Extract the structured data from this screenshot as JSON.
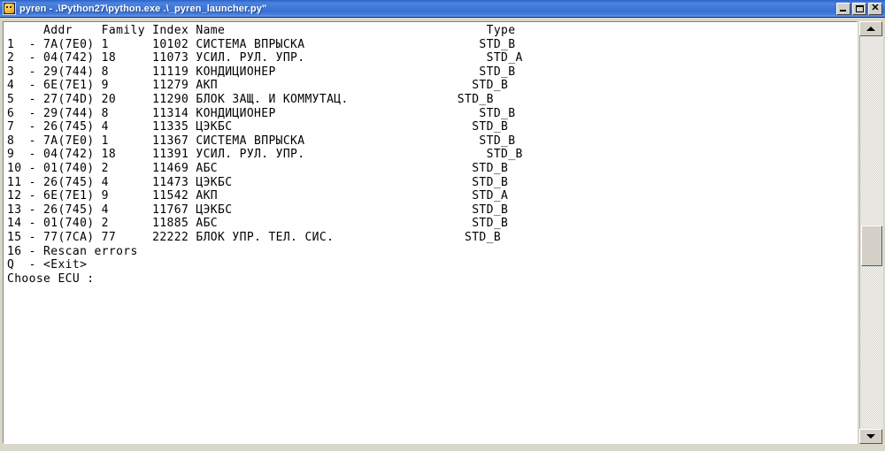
{
  "window": {
    "title": "pyren - .\\Python27\\python.exe .\\_pyren_launcher.py\"",
    "icon": "python-app-icon",
    "minimize_label": "",
    "maximize_label": "",
    "close_label": "✕",
    "colors": {
      "titlebar_blue": "#3a72d6",
      "frame_gray": "#d9d7c9",
      "console_bg": "#ffffff",
      "console_fg": "#000000",
      "button_face": "#d4d0c8"
    }
  },
  "scrollbar": {
    "up_arrow": "scroll-up-arrow",
    "down_arrow": "scroll-down-arrow",
    "thumb": "scroll-thumb"
  },
  "console": {
    "columns": [
      "Addr",
      "Family",
      "Index",
      "Name",
      "Type"
    ],
    "header_line": "     Addr    Family Index Name                                    Type",
    "rows": [
      {
        "n": "1",
        "addr": "7A(7E0)",
        "family": "1",
        "index": "10102",
        "name": "СИСТЕМА ВПРЫСКА",
        "type": "STD_B"
      },
      {
        "n": "2",
        "addr": "04(742)",
        "family": "18",
        "index": "11073",
        "name": "УСИЛ. РУЛ. УПР.",
        "type": "STD_A"
      },
      {
        "n": "3",
        "addr": "29(744)",
        "family": "8",
        "index": "11119",
        "name": "КОНДИЦИОНЕР",
        "type": "STD_B"
      },
      {
        "n": "4",
        "addr": "6E(7E1)",
        "family": "9",
        "index": "11279",
        "name": "АКП",
        "type": "STD_B"
      },
      {
        "n": "5",
        "addr": "27(74D)",
        "family": "20",
        "index": "11290",
        "name": "БЛОК ЗАЩ. И КОММУТАЦ.",
        "type": "STD_B"
      },
      {
        "n": "6",
        "addr": "29(744)",
        "family": "8",
        "index": "11314",
        "name": "КОНДИЦИОНЕР",
        "type": "STD_B"
      },
      {
        "n": "7",
        "addr": "26(745)",
        "family": "4",
        "index": "11335",
        "name": "ЦЭКБС",
        "type": "STD_B"
      },
      {
        "n": "8",
        "addr": "7A(7E0)",
        "family": "1",
        "index": "11367",
        "name": "СИСТЕМА ВПРЫСКА",
        "type": "STD_B"
      },
      {
        "n": "9",
        "addr": "04(742)",
        "family": "18",
        "index": "11391",
        "name": "УСИЛ. РУЛ. УПР.",
        "type": "STD_B"
      },
      {
        "n": "10",
        "addr": "01(740)",
        "family": "2",
        "index": "11469",
        "name": "АБС",
        "type": "STD_B"
      },
      {
        "n": "11",
        "addr": "26(745)",
        "family": "4",
        "index": "11473",
        "name": "ЦЭКБС",
        "type": "STD_B"
      },
      {
        "n": "12",
        "addr": "6E(7E1)",
        "family": "9",
        "index": "11542",
        "name": "АКП",
        "type": "STD_A"
      },
      {
        "n": "13",
        "addr": "26(745)",
        "family": "4",
        "index": "11767",
        "name": "ЦЭКБС",
        "type": "STD_B"
      },
      {
        "n": "14",
        "addr": "01(740)",
        "family": "2",
        "index": "11885",
        "name": "АБС",
        "type": "STD_B"
      },
      {
        "n": "15",
        "addr": "77(7CA)",
        "family": "77",
        "index": "22222",
        "name": "БЛОК УПР. ТЕЛ. СИС.",
        "type": "STD_B"
      }
    ],
    "menu_extra": [
      "16 - Rescan errors",
      "Q  - <Exit>"
    ],
    "prompt": "Choose ECU :",
    "text": "     Addr    Family Index Name                                    Type\n1  - 7A(7E0) 1      10102 СИСТЕМА ВПРЫСКА                        STD_B\n2  - 04(742) 18     11073 УСИЛ. РУЛ. УПР.                         STD_A\n3  - 29(744) 8      11119 КОНДИЦИОНЕР                            STD_B\n4  - 6E(7E1) 9      11279 АКП                                   STD_B\n5  - 27(74D) 20     11290 БЛОК ЗАЩ. И КОММУТАЦ.               STD_B\n6  - 29(744) 8      11314 КОНДИЦИОНЕР                            STD_B\n7  - 26(745) 4      11335 ЦЭКБС                                 STD_B\n8  - 7A(7E0) 1      11367 СИСТЕМА ВПРЫСКА                        STD_B\n9  - 04(742) 18     11391 УСИЛ. РУЛ. УПР.                         STD_B\n10 - 01(740) 2      11469 АБС                                   STD_B\n11 - 26(745) 4      11473 ЦЭКБС                                 STD_B\n12 - 6E(7E1) 9      11542 АКП                                   STD_A\n13 - 26(745) 4      11767 ЦЭКБС                                 STD_B\n14 - 01(740) 2      11885 АБС                                   STD_B\n15 - 77(7CA) 77     22222 БЛОК УПР. ТЕЛ. СИС.                  STD_B\n16 - Rescan errors\nQ  - <Exit>\nChoose ECU :"
  }
}
